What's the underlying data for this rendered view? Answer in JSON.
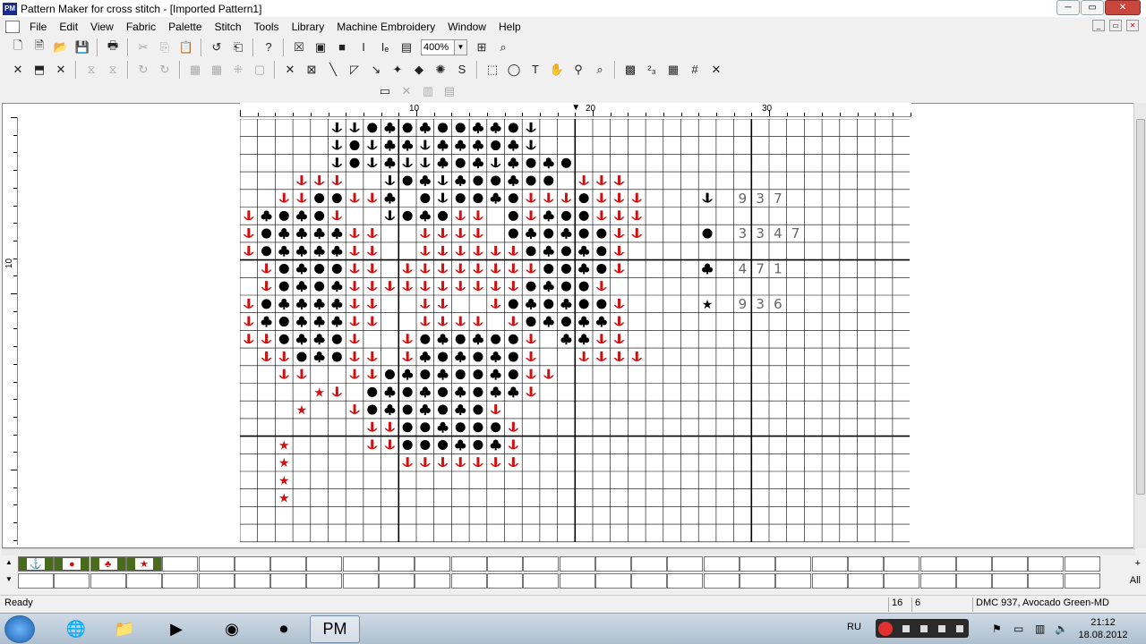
{
  "window": {
    "title": "Pattern Maker for cross stitch - [Imported Pattern1]",
    "logo_text": "PM",
    "minimize": "─",
    "restore": "▭",
    "close": "✕"
  },
  "menu": [
    "File",
    "Edit",
    "View",
    "Fabric",
    "Palette",
    "Stitch",
    "Tools",
    "Library",
    "Machine Embroidery",
    "Window",
    "Help"
  ],
  "toolbar": {
    "row1": [
      "🗋",
      "🗎",
      "📂",
      "💾",
      "🖶",
      "✂",
      "⎘",
      "📋",
      "↺",
      "⎗",
      "?",
      "☒",
      "▣",
      "■",
      "I",
      "Iₑ",
      "▤"
    ],
    "zoom_value": "400%",
    "row1_after": [
      "⊞",
      "⌕"
    ],
    "row2": [
      "✕",
      "⬒",
      "✕",
      "⧖",
      "⧖",
      "↻",
      "↻",
      "▦",
      "▦",
      "⁜",
      "▢",
      "✕",
      "⊠",
      "╲",
      "◸",
      "↘",
      "✦",
      "◆",
      "✺",
      "S",
      "⬚",
      "◯",
      "T",
      "✋",
      "⚲",
      "⌕",
      "▩",
      "²₃",
      "▦",
      "#",
      "✕"
    ],
    "row3": [
      "▭",
      "✕",
      "▥",
      "▤"
    ]
  },
  "ruler": {
    "top_labels": [
      "10",
      "20",
      "30"
    ],
    "left_labels": [
      "10"
    ]
  },
  "chart_data": {
    "type": "table",
    "rows": 24,
    "cols": 38,
    "symbols": {
      "A": "anchor-red",
      "B": "anchor-black",
      "C": "filled-circle",
      "D": "club",
      "S": "star-red"
    },
    "grid": [
      "     BBCDCDCCDDCB                      ",
      "     BCBDDBDDDCDB                      ",
      "     BCBDBBDCDBDCDC                    ",
      "   AAA  BCDBDCCDCC AAA                 ",
      "  AACCAAD CBCCDCAAACAAA                ",
      "ADCDCA  BCDCAA CADCCAAA                ",
      "ACDDDDAA  AAAA CDCDCCAA                ",
      "ACDDDDAA  AAAAAACDCDCA                 ",
      " ACDCCAA AAAAAAAACCDCA                 ",
      " ACDCDAAAAAAAAAACDCCA                  ",
      "ACDDDDAA  AA  ACDCDCCA                 ",
      "ADCDDDAA  AAAA ACDCDDA                 ",
      "AACDDCA  ACDCDCCA DDAA                 ",
      " AACDCAA ADCDCDCA  AAAA                ",
      "  AA  AACDCDCCDCAA                     ",
      "    SA CDCDCDCDDA                      ",
      "   S  ACDCDCDCA                        ",
      "       AACCDCCCA                       ",
      "  S    AACCCDCDA                       ",
      "  S      AAAAAAA                       ",
      "  S                                    ",
      "  S                                    ",
      "                                       ",
      "                                       "
    ],
    "legend": [
      {
        "symbol": "anchor-black",
        "code": "937"
      },
      {
        "symbol": "filled-circle",
        "code": "3347"
      },
      {
        "symbol": "club",
        "code": "471"
      },
      {
        "symbol": "star-black",
        "code": "936"
      }
    ]
  },
  "palette": {
    "items": [
      {
        "symbol": "anchor-red",
        "glyph": "⚓"
      },
      {
        "symbol": "filled-circle-red",
        "glyph": "●"
      },
      {
        "symbol": "club-red",
        "glyph": "♣"
      },
      {
        "symbol": "star-red",
        "glyph": "★"
      }
    ],
    "empty_cells": 26,
    "right_labels": [
      "+",
      "All"
    ]
  },
  "status": {
    "ready": "Ready",
    "x": "16",
    "y": "6",
    "color": "DMC 937, Avocado Green-MD"
  },
  "taskbar": {
    "lang": "RU",
    "time": "21:12",
    "date": "18.08.2012"
  }
}
